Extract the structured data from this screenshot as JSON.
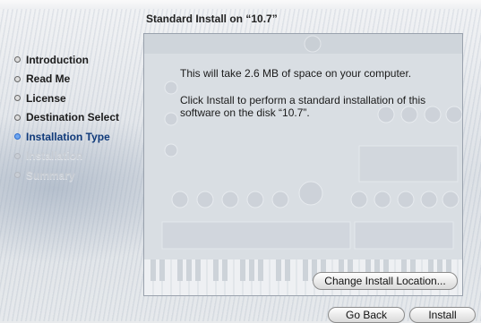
{
  "window": {
    "title": "Standard Install on “10.7”"
  },
  "sidebar": {
    "steps": [
      {
        "label": "Introduction",
        "state": "done"
      },
      {
        "label": "Read Me",
        "state": "done"
      },
      {
        "label": "License",
        "state": "done"
      },
      {
        "label": "Destination Select",
        "state": "done"
      },
      {
        "label": "Installation Type",
        "state": "active"
      },
      {
        "label": "Installation",
        "state": "pending"
      },
      {
        "label": "Summary",
        "state": "pending"
      }
    ]
  },
  "main": {
    "space_message": "This will take 2.6 MB of space on your computer.",
    "instruction_message": "Click Install to perform a standard installation of this software on the disk “10.7”."
  },
  "buttons": {
    "change_location": "Change Install Location...",
    "go_back": "Go Back",
    "install": "Install"
  },
  "colors": {
    "active_step": "#103a7a",
    "active_bullet": "#6fa6ee",
    "pending_step": "#c7ccd3"
  }
}
